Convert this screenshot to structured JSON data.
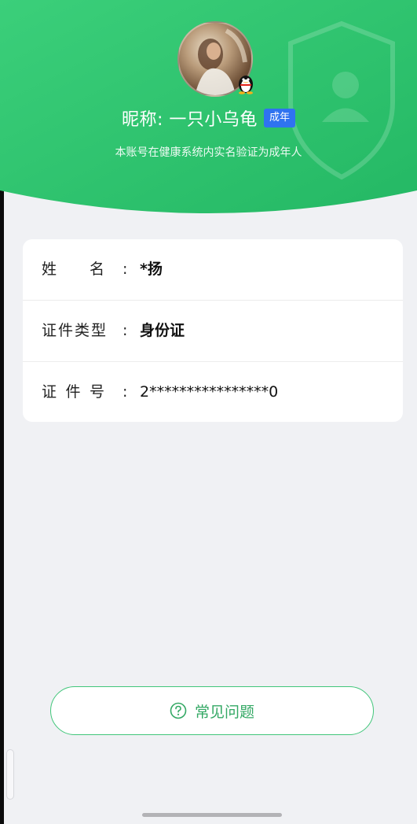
{
  "profile": {
    "nickname": "昵称: 一只小乌龟",
    "age_badge": "成年",
    "verification_note": "本账号在健康系统内实名验证为成年人",
    "avatar_icon": "user-avatar-photo",
    "platform_icon": "qq-penguin-icon"
  },
  "info": {
    "name_label_chars": [
      "姓",
      "名"
    ],
    "name_value": "*扬",
    "id_type_label": "证件类型",
    "id_type_value": "身份证",
    "id_number_label_chars": [
      "证",
      "件",
      "号"
    ],
    "id_number_value": "2****************0",
    "colon": ":"
  },
  "actions": {
    "faq_label": "常见问题",
    "faq_icon": "question-circle-icon"
  },
  "colors": {
    "header_green": "#2fc46e",
    "accent_green": "#41c67a",
    "badge_blue": "#2f73f0",
    "page_bg": "#f0f1f4"
  }
}
